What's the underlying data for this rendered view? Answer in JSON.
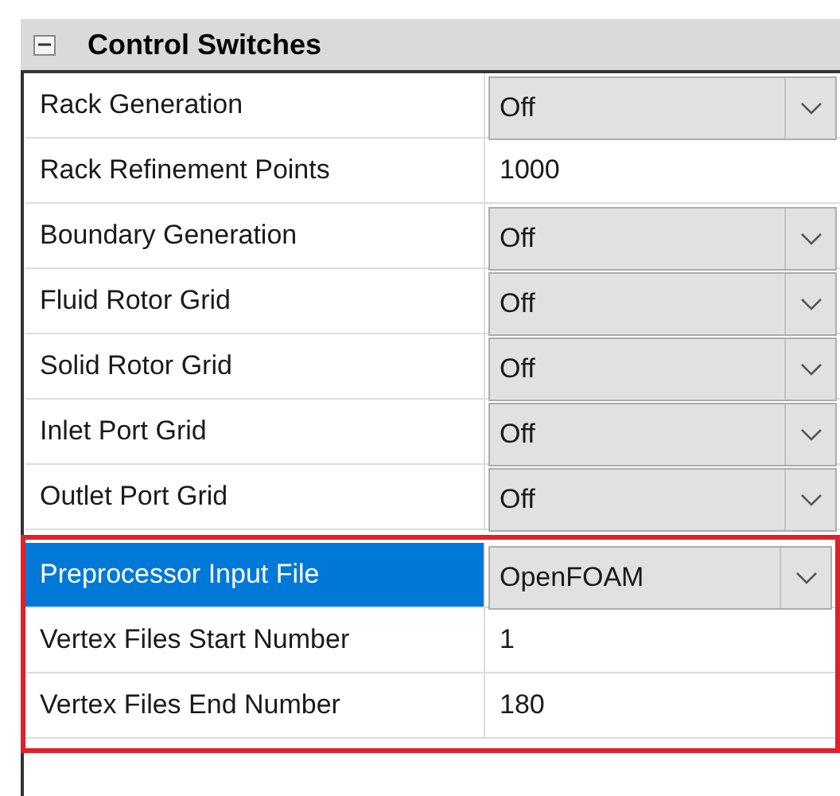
{
  "category": {
    "title": "Control Switches",
    "expanded": true
  },
  "row_groups": [
    {
      "highlighted": false,
      "rows": [
        {
          "label": "Rack Generation",
          "kind": "dropdown",
          "value": "Off",
          "selected": false
        },
        {
          "label": "Rack Refinement Points",
          "kind": "text",
          "value": "1000",
          "selected": false
        },
        {
          "label": "Boundary Generation",
          "kind": "dropdown",
          "value": "Off",
          "selected": false
        },
        {
          "label": "Fluid Rotor Grid",
          "kind": "dropdown",
          "value": "Off",
          "selected": false
        },
        {
          "label": "Solid Rotor Grid",
          "kind": "dropdown",
          "value": "Off",
          "selected": false
        },
        {
          "label": "Inlet Port Grid",
          "kind": "dropdown",
          "value": "Off",
          "selected": false
        },
        {
          "label": "Outlet Port Grid",
          "kind": "dropdown",
          "value": "Off",
          "selected": false
        }
      ]
    },
    {
      "highlighted": true,
      "rows": [
        {
          "label": "Preprocessor Input File",
          "kind": "dropdown",
          "value": "OpenFOAM",
          "selected": true
        },
        {
          "label": "Vertex Files Start Number",
          "kind": "text",
          "value": "1",
          "selected": false
        },
        {
          "label": "Vertex Files End Number",
          "kind": "text",
          "value": "180",
          "selected": false
        }
      ]
    }
  ]
}
